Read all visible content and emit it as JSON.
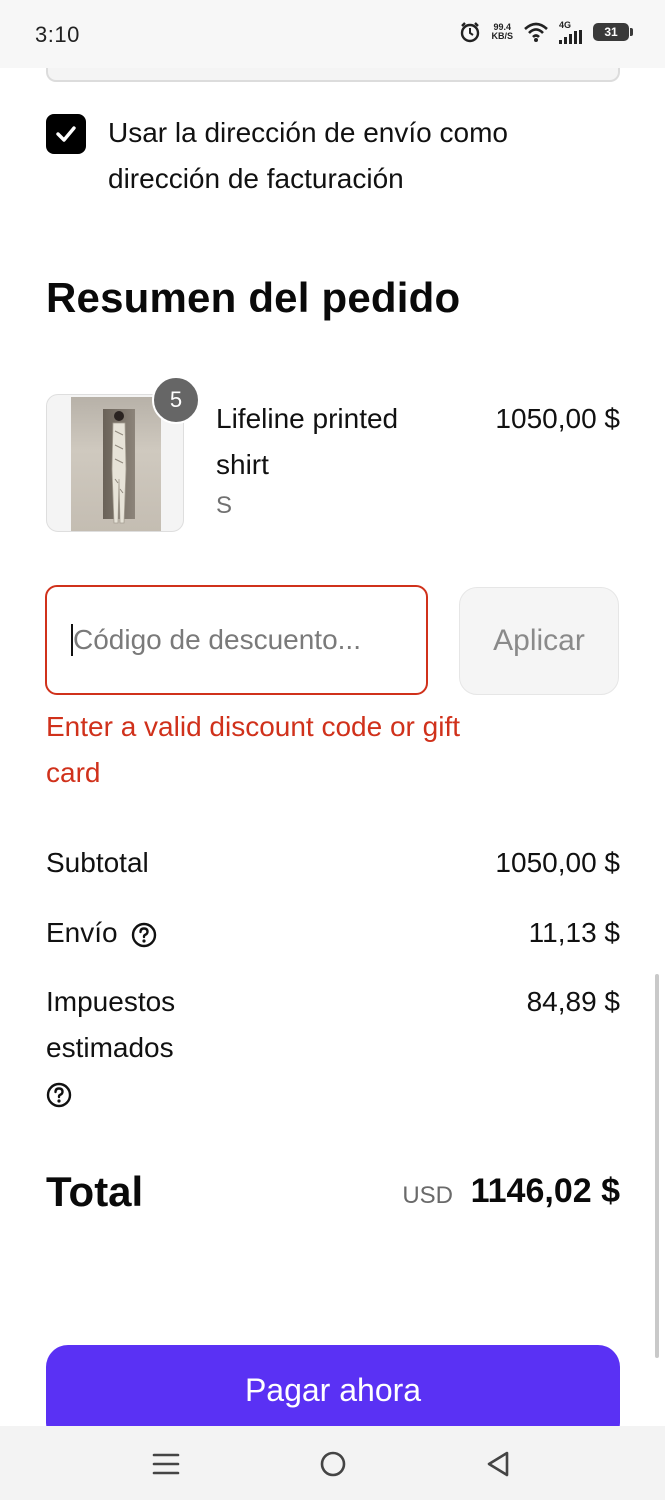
{
  "status_bar": {
    "time": "3:10",
    "net_speed_value": "99.4",
    "net_speed_unit": "KB/S",
    "network_type": "4G",
    "battery_level": "31",
    "icons": [
      "alarm-icon",
      "wifi-icon",
      "signal-icon",
      "battery-icon"
    ]
  },
  "billing": {
    "checkbox_checked": true,
    "label": "Usar la dirección de envío como dirección de facturación"
  },
  "order_summary": {
    "title": "Resumen del pedido",
    "item": {
      "name": "Lifeline printed shirt",
      "variant": "S",
      "quantity": "5",
      "price": "1050,00 $"
    }
  },
  "discount": {
    "placeholder": "Código de descuento...",
    "value": "",
    "apply_label": "Aplicar",
    "error": "Enter a valid discount code or gift card"
  },
  "totals": {
    "subtotal_label": "Subtotal",
    "subtotal_value": "1050,00 $",
    "shipping_label": "Envío",
    "shipping_value": "11,13 $",
    "tax_label": "Impuestos estimados",
    "tax_value": "84,89 $",
    "total_label": "Total",
    "total_currency": "USD",
    "total_value": "1146,02 $"
  },
  "pay_button_label": "Pagar ahora",
  "colors": {
    "accent": "#5a31f4",
    "error": "#d0311b",
    "checkbox": "#000000"
  }
}
